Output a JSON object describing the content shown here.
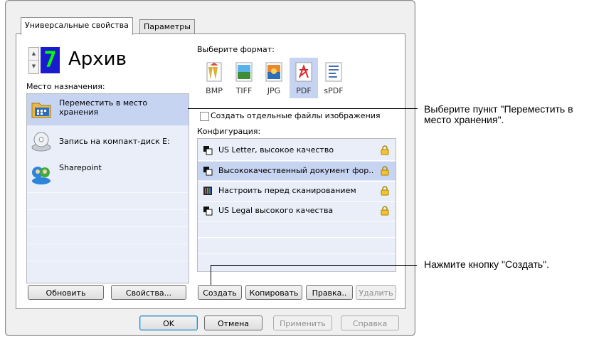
{
  "tabs": [
    "Универсальные свойства",
    "Параметры"
  ],
  "profile": {
    "number": "7",
    "title": "Архив"
  },
  "destination": {
    "label": "Место назначения:",
    "items": [
      {
        "label": "Переместить в место хранения",
        "icon": "folder-storage-icon"
      },
      {
        "label": "Запись на компакт-диск  E:",
        "icon": "cd-burn-icon"
      },
      {
        "label": "Sharepoint",
        "icon": "sharepoint-icon"
      }
    ]
  },
  "format": {
    "label": "Выберите формат:",
    "items": [
      {
        "label": "BMP",
        "icon": "bmp-icon"
      },
      {
        "label": "TIFF",
        "icon": "tiff-icon"
      },
      {
        "label": "JPG",
        "icon": "jpg-icon"
      },
      {
        "label": "PDF",
        "icon": "pdf-icon"
      },
      {
        "label": "sPDF",
        "icon": "spdf-icon"
      }
    ],
    "separate_files": "Создать отдельные файлы изображения"
  },
  "config": {
    "label": "Конфигурация:",
    "items": [
      {
        "label": "US Letter, высокое качество",
        "icon": "scan-icon"
      },
      {
        "label": "Высококачественный документ фор...",
        "icon": "scan-icon"
      },
      {
        "label": "Настроить перед сканированием",
        "icon": "configure-icon"
      },
      {
        "label": "US Legal высокого качества",
        "icon": "scan-icon"
      }
    ]
  },
  "buttons": {
    "refresh": "Обновить",
    "properties": "Свойства...",
    "create": "Создать",
    "copy": "Копировать",
    "edit": "Правка..",
    "delete": "Удалить",
    "ok": "OK",
    "cancel": "Отмена",
    "apply": "Применить",
    "help": "Справка"
  },
  "callouts": {
    "move": "Выберите пункт \"Переместить в место хранения\".",
    "create": "Нажмите кнопку \"Создать\"."
  },
  "colors": {
    "selection": "#c6d3f1",
    "list_bg": "#e9eef9",
    "number_bg": "#1a1ad0",
    "number_fg": "#00ff00"
  }
}
